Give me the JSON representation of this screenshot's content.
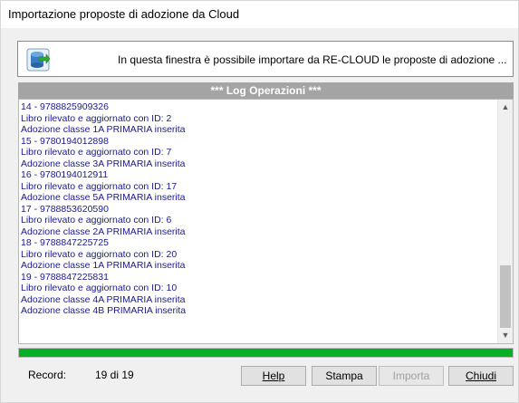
{
  "window": {
    "title": "Importazione proposte di adozione da Cloud"
  },
  "banner": {
    "icon": "database-import-icon",
    "text": "In questa finestra è possibile importare da RE-CLOUD le proposte di adozione ..."
  },
  "log": {
    "header": "*** Log Operazioni ***",
    "lines": [
      "14 - 9788825909326",
      "Libro rilevato e aggiornato con ID: 2",
      "Adozione classe 1A PRIMARIA inserita",
      "15 - 9780194012898",
      "Libro rilevato e aggiornato con ID: 7",
      "Adozione classe 3A PRIMARIA inserita",
      "16 - 9780194012911",
      "Libro rilevato e aggiornato con ID: 17",
      "Adozione classe 5A PRIMARIA inserita",
      "17 - 9788853620590",
      "Libro rilevato e aggiornato con ID: 6",
      "Adozione classe 2A PRIMARIA inserita",
      "18 - 9788847225725",
      "Libro rilevato e aggiornato con ID: 20",
      "Adozione classe 1A PRIMARIA inserita",
      "19 - 9788847225831",
      "Libro rilevato e aggiornato con ID: 10",
      "Adozione classe 4A PRIMARIA inserita",
      "Adozione classe 4B PRIMARIA inserita"
    ]
  },
  "progress": {
    "fraction": 1.0,
    "color": "#06b025"
  },
  "record": {
    "label": "Record:",
    "value": "19 di 19"
  },
  "buttons": {
    "help": "Help",
    "stampa": "Stampa",
    "importa": "Importa",
    "chiudi": "Chiudi"
  }
}
